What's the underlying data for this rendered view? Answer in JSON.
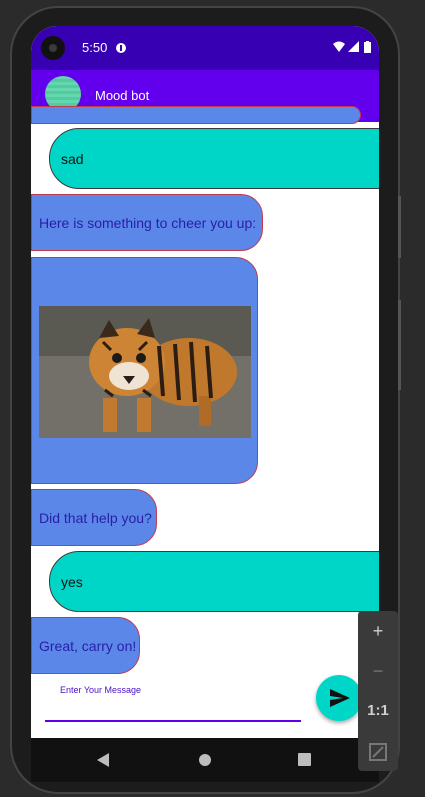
{
  "status": {
    "time": "5:50"
  },
  "app": {
    "title": "Mood bot"
  },
  "messages": [
    {
      "text": "sad"
    },
    {
      "text": "Here is something to cheer you up:"
    },
    {
      "text": "Did that help you?"
    },
    {
      "text": "yes"
    },
    {
      "text": "Great, carry on!"
    }
  ],
  "input": {
    "placeholder": "Enter Your Message"
  },
  "zoom": {
    "plus": "+",
    "minus": "−",
    "ratio": "1:1"
  },
  "colors": {
    "statusbar": "#3700b3",
    "appbar": "#6200ee",
    "bot_bubble": "#5b87e8",
    "user_bubble": "#00d6c8",
    "fab": "#00d6c8"
  }
}
